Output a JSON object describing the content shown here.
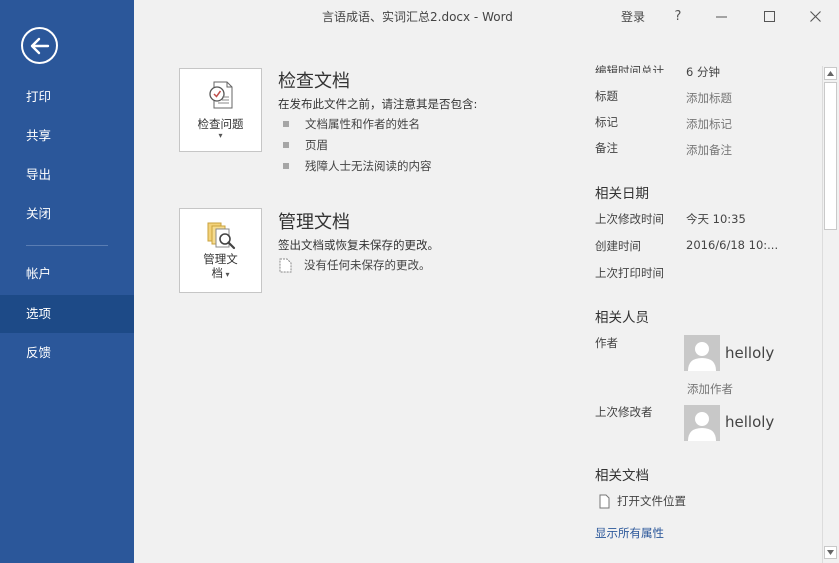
{
  "window": {
    "title": "言语成语、实词汇总2.docx - Word",
    "login_label": "登录",
    "help_label": "?",
    "minimize_label": "—",
    "restore_label": "☐",
    "close_label": "✕"
  },
  "sidebar": {
    "back_icon": "back-arrow-icon",
    "items": [
      {
        "label": "打印"
      },
      {
        "label": "共享"
      },
      {
        "label": "导出"
      },
      {
        "label": "关闭"
      },
      {
        "label": "帐户"
      },
      {
        "label": "选项",
        "active": true
      },
      {
        "label": "反馈"
      }
    ]
  },
  "inspect": {
    "button_label": "检查问题",
    "title": "检查文档",
    "description": "在发布此文件之前，请注意其是否包含:",
    "bullets": [
      "文档属性和作者的姓名",
      "页眉",
      "残障人士无法阅读的内容"
    ]
  },
  "manage": {
    "button_label_line1": "管理文",
    "button_label_line2": "档",
    "title": "管理文档",
    "description": "签出文档或恢复未保存的更改。",
    "note": "没有任何未保存的更改。"
  },
  "properties": {
    "edit_time_label": "编辑时间总计",
    "edit_time_value": "6 分钟",
    "title_label": "标题",
    "title_placeholder": "添加标题",
    "tags_label": "标记",
    "tags_placeholder": "添加标记",
    "comments_label": "备注",
    "comments_placeholder": "添加备注",
    "dates_heading": "相关日期",
    "modified_label": "上次修改时间",
    "modified_value": "今天 10:35",
    "created_label": "创建时间",
    "created_value": "2016/6/18 10:...",
    "printed_label": "上次打印时间",
    "people_heading": "相关人员",
    "author_label": "作者",
    "author_name": "helloly",
    "add_author": "添加作者",
    "last_modified_by_label": "上次修改者",
    "last_modified_by_name": "helloly",
    "docs_heading": "相关文档",
    "open_location": "打开文件位置",
    "show_all": "显示所有属性"
  },
  "colors": {
    "sidebar_bg": "#2b579a",
    "sidebar_active": "#1d4a87",
    "content_bg": "#f1f1f1",
    "link": "#2b579a"
  }
}
